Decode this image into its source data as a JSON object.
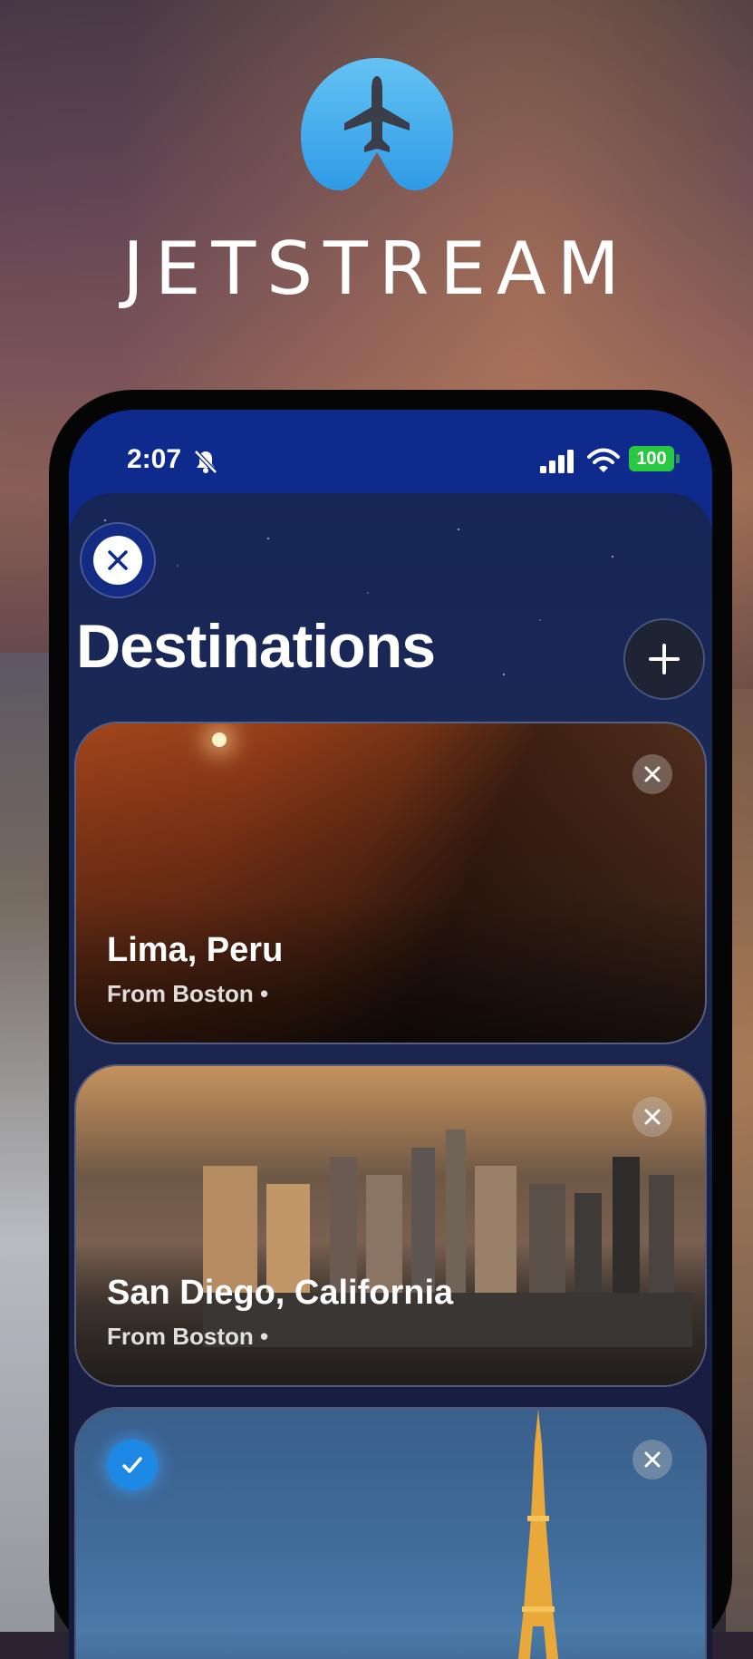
{
  "brand": {
    "name": "JETSTREAM",
    "logo_icon": "airplane-logo-icon"
  },
  "status_bar": {
    "time": "2:07",
    "battery": "100",
    "silent_icon": "bell-slash-icon",
    "signal_icon": "cellular-signal-icon",
    "wifi_icon": "wifi-icon"
  },
  "header": {
    "title": "Destinations",
    "close_icon": "close-icon",
    "add_icon": "plus-icon"
  },
  "destinations": [
    {
      "name": "Lima, Peru",
      "subtitle": "From Boston •",
      "selected": false
    },
    {
      "name": "San Diego, California",
      "subtitle": "From Boston •",
      "selected": false
    },
    {
      "name": "",
      "subtitle": "",
      "selected": true
    }
  ],
  "colors": {
    "accent": "#1e88e5",
    "sheet_bg": "#0d2a8c",
    "battery": "#28c840",
    "logo": "#4fb4f0"
  }
}
